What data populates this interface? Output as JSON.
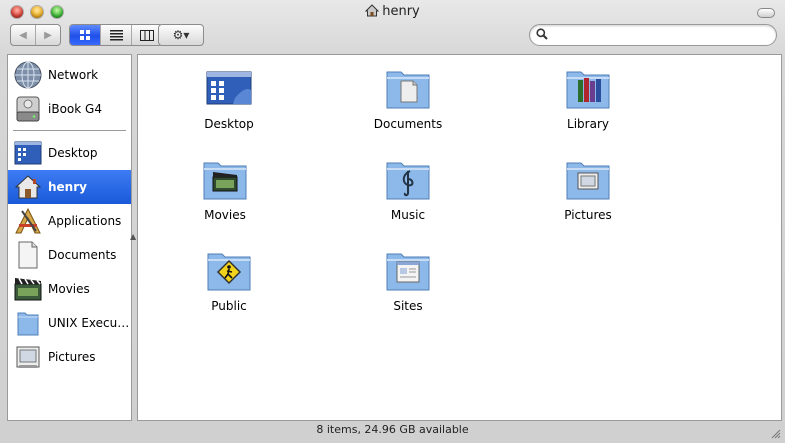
{
  "window": {
    "title": "henry",
    "status": "8 items, 24.96 GB available"
  },
  "toolbar": {
    "back_glyph": "◀",
    "forward_glyph": "▶",
    "action_glyph": "⚙▾",
    "search_value": "",
    "search_placeholder": ""
  },
  "sidebar": {
    "devices": [
      {
        "label": "Network",
        "icon": "network-globe-icon"
      },
      {
        "label": "iBook G4",
        "icon": "hard-drive-icon"
      }
    ],
    "places": [
      {
        "label": "Desktop",
        "icon": "desktop-icon"
      },
      {
        "label": "henry",
        "icon": "home-icon",
        "selected": true
      },
      {
        "label": "Applications",
        "icon": "applications-icon"
      },
      {
        "label": "Documents",
        "icon": "documents-icon"
      },
      {
        "label": "Movies",
        "icon": "movies-icon"
      },
      {
        "label": "UNIX Execu…",
        "icon": "folder-icon"
      },
      {
        "label": "Pictures",
        "icon": "pictures-icon"
      }
    ]
  },
  "content": {
    "items": [
      {
        "label": "Desktop",
        "icon": "desktop-folder-icon"
      },
      {
        "label": "Documents",
        "icon": "documents-folder-icon"
      },
      {
        "label": "Library",
        "icon": "library-folder-icon"
      },
      {
        "label": "Movies",
        "icon": "movies-folder-icon"
      },
      {
        "label": "Music",
        "icon": "music-folder-icon"
      },
      {
        "label": "Pictures",
        "icon": "pictures-folder-icon"
      },
      {
        "label": "Public",
        "icon": "public-folder-icon"
      },
      {
        "label": "Sites",
        "icon": "sites-folder-icon"
      }
    ]
  },
  "colors": {
    "selection": "#1a5ad8",
    "folder_blue": "#8db8ea"
  }
}
